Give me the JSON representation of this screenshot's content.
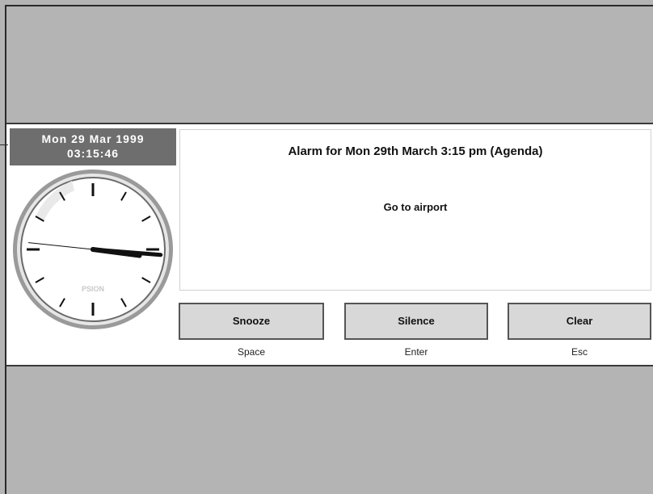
{
  "datetime": {
    "date": "Mon 29 Mar 1999",
    "time": "03:15:46"
  },
  "clock": {
    "brand": "PSION",
    "hour": 3,
    "minute": 15,
    "second": 46
  },
  "alarm": {
    "title": "Alarm for Mon 29th March 3:15 pm (Agenda)",
    "text": "Go to airport"
  },
  "buttons": {
    "snooze": {
      "label": "Snooze",
      "shortcut": "Space"
    },
    "silence": {
      "label": "Silence",
      "shortcut": "Enter"
    },
    "clear": {
      "label": "Clear",
      "shortcut": "Esc"
    }
  }
}
